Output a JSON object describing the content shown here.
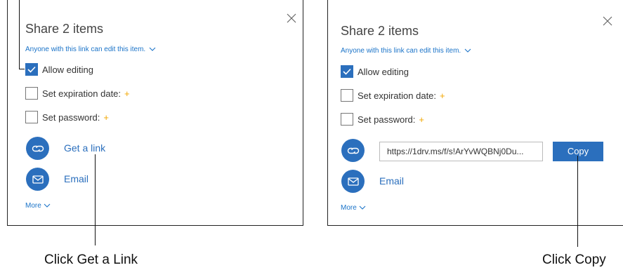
{
  "left_dialog": {
    "title": "Share 2 items",
    "permission_text": "Anyone with this link can edit this item.",
    "options": {
      "allow_editing": {
        "label": "Allow editing",
        "checked": true
      },
      "expiration": {
        "label": "Set expiration date:",
        "checked": false,
        "premium_marker": "+"
      },
      "password": {
        "label": "Set password:",
        "checked": false,
        "premium_marker": "+"
      }
    },
    "actions": {
      "get_link": "Get a link",
      "email": "Email"
    },
    "more": "More"
  },
  "right_dialog": {
    "title": "Share 2 items",
    "permission_text": "Anyone with this link can edit this item.",
    "options": {
      "allow_editing": {
        "label": "Allow editing",
        "checked": true
      },
      "expiration": {
        "label": "Set expiration date:",
        "checked": false,
        "premium_marker": "+"
      },
      "password": {
        "label": "Set password:",
        "checked": false,
        "premium_marker": "+"
      }
    },
    "link_value": "https://1drv.ms/f/s!ArYvWQBNj0Du...",
    "copy_label": "Copy",
    "actions": {
      "email": "Email"
    },
    "more": "More"
  },
  "callouts": {
    "get_link": "Click Get a Link",
    "copy": "Click Copy"
  },
  "colors": {
    "accent": "#2b6fbd",
    "link": "#1a73c8",
    "premium_star": "#f2a700"
  },
  "icons": [
    "close-icon",
    "checkmark-icon",
    "chevron-down-icon",
    "link-icon",
    "mail-icon"
  ]
}
